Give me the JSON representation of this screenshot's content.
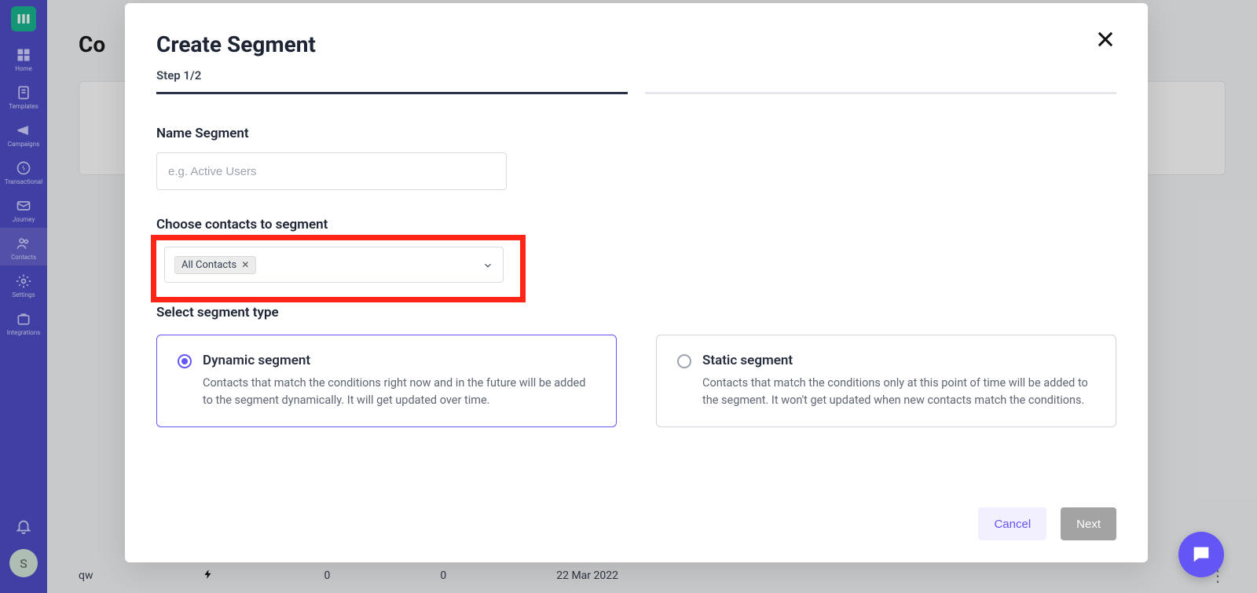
{
  "sidebar": {
    "logo_letter": "M",
    "items": [
      {
        "label": "Home"
      },
      {
        "label": "Templates"
      },
      {
        "label": "Campaigns"
      },
      {
        "label": "Transactional"
      },
      {
        "label": "Journey"
      },
      {
        "label": "Contacts"
      },
      {
        "label": "Settings"
      },
      {
        "label": "Integrations"
      }
    ],
    "avatar_letter": "S"
  },
  "page": {
    "title_partial": "Co",
    "row": {
      "name": "qw",
      "col1": "0",
      "col2": "0",
      "date": "22 Mar 2022"
    }
  },
  "modal": {
    "title": "Create Segment",
    "step_label": "Step 1/2",
    "name_section_label": "Name Segment",
    "name_placeholder": "e.g. Active Users",
    "choose_label": "Choose contacts to segment",
    "selected_chip": "All Contacts",
    "segment_type_label": "Select segment type",
    "options": [
      {
        "title": "Dynamic segment",
        "desc": "Contacts that match the conditions right now and in the future will be added to the segment dynamically. It will get updated over time.",
        "selected": true
      },
      {
        "title": "Static segment",
        "desc": "Contacts that match the conditions only at this point of time will be added to the segment. It won't get updated when new contacts match the conditions.",
        "selected": false
      }
    ],
    "cancel_label": "Cancel",
    "next_label": "Next"
  }
}
